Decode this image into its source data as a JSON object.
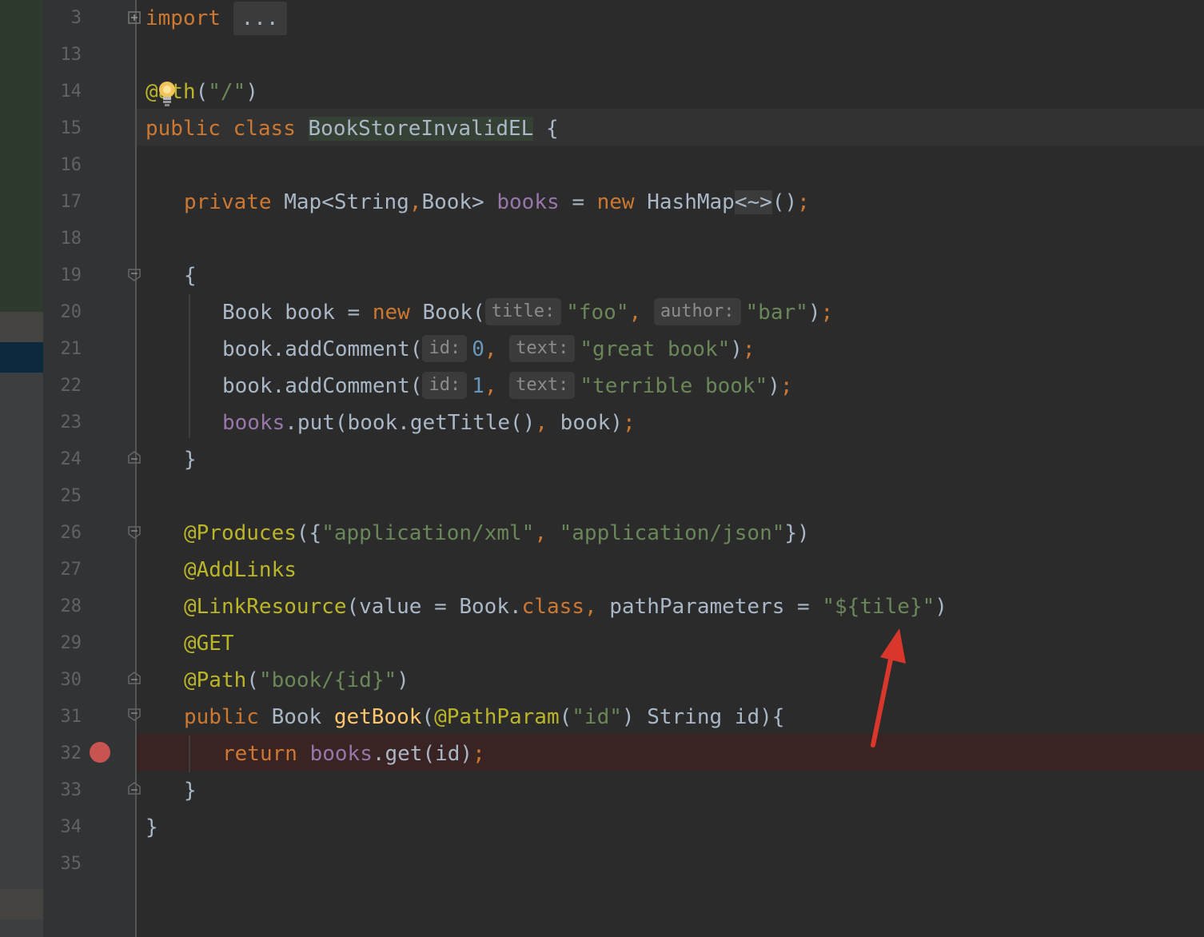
{
  "colors": {
    "keyword": "#cc7832",
    "annotation": "#bbb529",
    "string": "#6a8759",
    "number": "#6897bb",
    "field": "#9876aa",
    "method": "#ffc66d",
    "plain": "#a9b7c6",
    "breakpoint": "#c75450",
    "arrow": "#d9372b"
  },
  "icons": {
    "fold": "fold-marker-icon",
    "breakpoint": "breakpoint-icon",
    "intention": "lightbulb-icon",
    "arrow": "red-arrow-annotation"
  },
  "line_numbers": [
    "3",
    "13",
    "14",
    "15",
    "16",
    "17",
    "18",
    "19",
    "20",
    "21",
    "22",
    "23",
    "24",
    "25",
    "26",
    "27",
    "28",
    "29",
    "30",
    "31",
    "32",
    "33",
    "34",
    "35"
  ],
  "code": {
    "l3": {
      "kw": "import",
      "folded": "..."
    },
    "l14": {
      "at": "@",
      "rest": "ath",
      "open": "(",
      "str": "\"/\"",
      "close": ")"
    },
    "l15": {
      "kw1": "public",
      "kw2": "class",
      "cls": "BookStoreInvalidEL",
      "brace": "{"
    },
    "l17": {
      "kw": "private",
      "type": "Map<String",
      "comma": ",",
      "type2": "Book>",
      "field": "books",
      "eq": "=",
      "kw2": "new",
      "ctor": "HashMap",
      "diamond": "<~>",
      "tail": "()",
      "semi": ";"
    },
    "l19": {
      "brace": "{"
    },
    "l20": {
      "pre": "Book book = ",
      "kw": "new",
      "ctor": " Book(",
      "hint1": "title:",
      "str1": "\"foo\"",
      "comma": ",",
      "hint2": "author:",
      "str2": "\"bar\"",
      "close": ")",
      "semi": ";"
    },
    "l21": {
      "pre": "book.addComment(",
      "hint1": "id:",
      "num": "0",
      "comma": ",",
      "hint2": "text:",
      "str": "\"great book\"",
      "close": ")",
      "semi": ";"
    },
    "l22": {
      "pre": "book.addComment(",
      "hint1": "id:",
      "num": "1",
      "comma": ",",
      "hint2": "text:",
      "str": "\"terrible book\"",
      "close": ")",
      "semi": ";"
    },
    "l23": {
      "field": "books",
      "mid": ".put(book.getTitle()",
      "comma": ",",
      "rest": " book)",
      "semi": ";"
    },
    "l24": {
      "brace": "}"
    },
    "l26": {
      "ann": "@Produces",
      "open": "({",
      "str1": "\"application/xml\"",
      "comma": ",",
      "str2": "\"application/json\"",
      "close": "})"
    },
    "l27": {
      "ann": "@AddLinks"
    },
    "l28": {
      "ann": "@LinkResource",
      "a": "(value = Book.",
      "kw": "class",
      "comma": ",",
      "b": " pathParameters = ",
      "str": "\"${tile}\"",
      "close": ")"
    },
    "l29": {
      "ann": "@GET"
    },
    "l30": {
      "ann": "@Path",
      "open": "(",
      "str": "\"book/{id}\"",
      "close": ")"
    },
    "l31": {
      "kw": "public",
      "type": " Book ",
      "mth": "getBook",
      "open": "(",
      "ann": "@PathParam",
      "open2": "(",
      "str": "\"id\"",
      "rest": ") String id){"
    },
    "l32": {
      "kw": "return",
      "field": " books",
      "rest": ".get(id)",
      "semi": ";"
    },
    "l33": {
      "brace": "}"
    },
    "l34": {
      "brace": "}"
    }
  }
}
